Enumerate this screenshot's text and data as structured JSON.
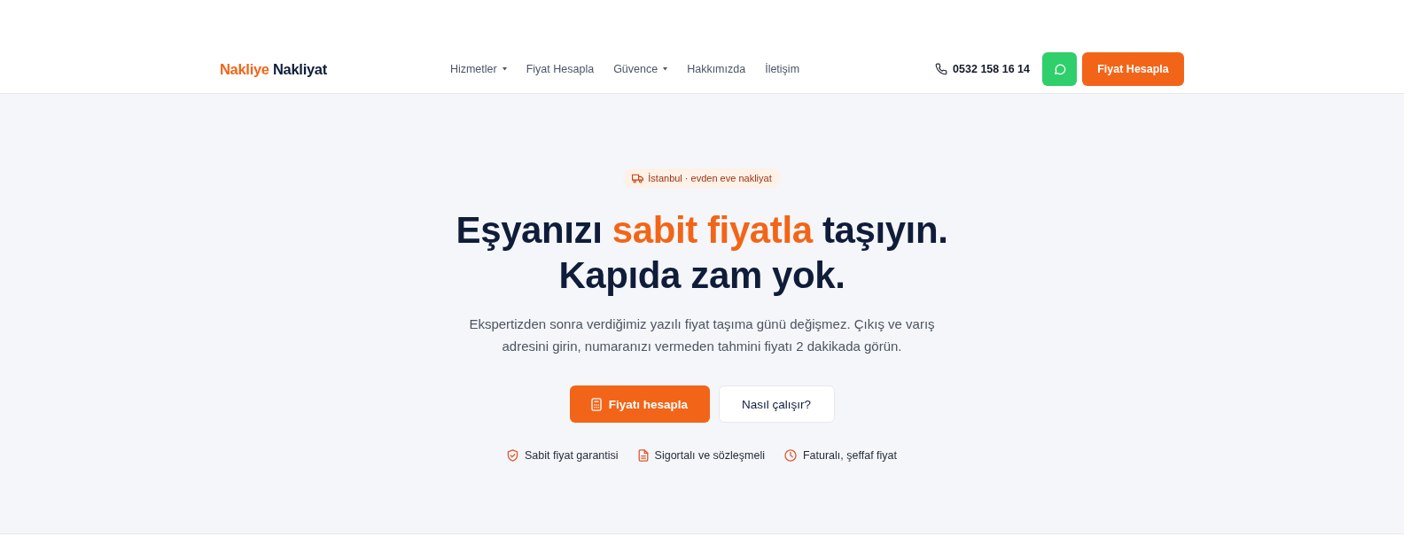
{
  "header": {
    "logo": {
      "accent": "Nakliye",
      "main": "Nakliyat"
    },
    "nav": [
      {
        "label": "Hizmetler",
        "dropdown": true
      },
      {
        "label": "Fiyat Hesapla",
        "dropdown": false
      },
      {
        "label": "Güvence",
        "dropdown": true
      },
      {
        "label": "Hakkımızda",
        "dropdown": false
      },
      {
        "label": "İletişim",
        "dropdown": false
      }
    ],
    "phone": "0532 158 16 14",
    "cta": "Fiyat Hesapla"
  },
  "hero": {
    "badge": "İstanbul · evden eve nakliyat",
    "headline": {
      "before": "Eşyanızı ",
      "highlight": "sabit fiyatla",
      "after": " taşıyın.",
      "line_2": "Kapıda zam yok."
    },
    "text": "Ekspertizden sonra verdiğimiz yazılı fiyat taşıma günü değişmez. Çıkış ve varış adresini girin, numaranızı vermeden tahmini fiyatı 2 dakikada görün.",
    "buttons": [
      {
        "label": "Fiyatı hesapla",
        "kind": "primary"
      },
      {
        "label": "Nasıl çalışır?",
        "kind": "secondary"
      }
    ],
    "features": [
      {
        "label": "Sabit fiyat garantisi",
        "kind": "guarantee"
      },
      {
        "label": "Sigortalı ve sözleşmeli",
        "kind": "insurance"
      },
      {
        "label": "Faturalı, şeffaf fiyat",
        "kind": "invoice"
      }
    ]
  }
}
